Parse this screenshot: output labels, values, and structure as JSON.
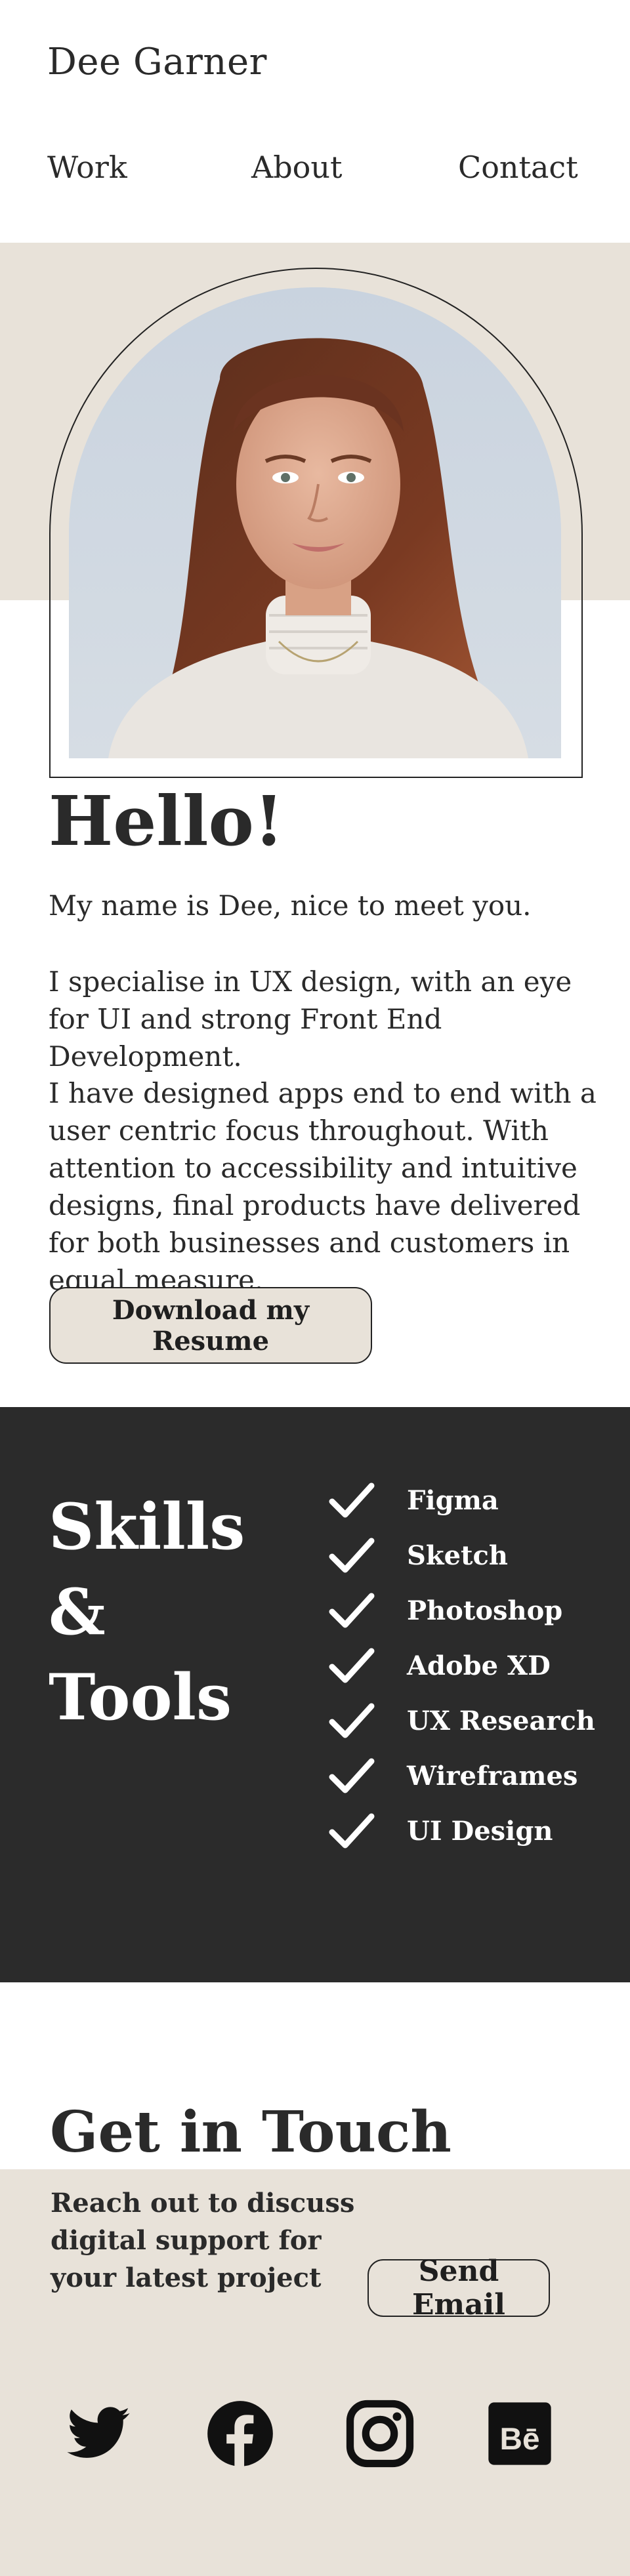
{
  "header": {
    "brand": "Dee Garner",
    "nav": [
      "Work",
      "About",
      "Contact"
    ]
  },
  "hero": {
    "greeting": "Hello!",
    "paragraphs": [
      "My name is Dee, nice to meet you.",
      "I specialise in UX design, with an eye for UI and strong Front End Development.",
      "I have designed apps end to end with a user centric focus throughout. With attention to accessibility and intuitive designs, final products have delivered for both businesses and customers in equal measure."
    ],
    "resume_button": "Download my Resume"
  },
  "skills": {
    "title_lines": [
      "Skills",
      "&",
      "Tools"
    ],
    "items": [
      "Figma",
      "Sketch",
      "Photoshop",
      "Adobe XD",
      "UX Research",
      "Wireframes",
      "UI Design"
    ]
  },
  "contact": {
    "title": "Get in Touch",
    "text": "Reach out to discuss digital support for your latest project",
    "email_button": "Send Email",
    "socials": [
      "twitter-icon",
      "facebook-icon",
      "instagram-icon",
      "behance-icon"
    ]
  },
  "colors": {
    "beige": "#e8e2d9",
    "dark": "#2b2b2b",
    "text": "#2a2a2a"
  }
}
